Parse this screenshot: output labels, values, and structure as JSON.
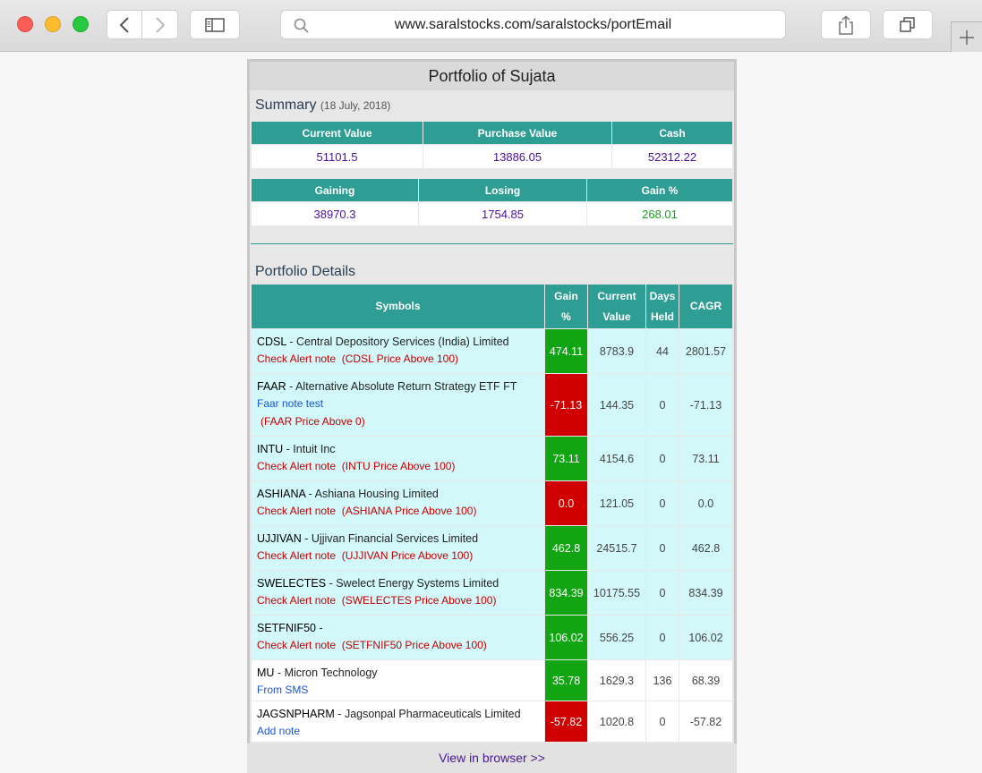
{
  "browser": {
    "url": "www.saralstocks.com/saralstocks/portEmail"
  },
  "portfolio": {
    "title": "Portfolio of Sujata",
    "summary_label": "Summary",
    "summary_date": "(18 July, 2018)",
    "summary1": {
      "headers": [
        "Current Value",
        "Purchase Value",
        "Cash"
      ],
      "values": [
        "51101.5",
        "13886.05",
        "52312.22"
      ]
    },
    "summary2": {
      "headers": [
        "Gaining",
        "Losing",
        "Gain %"
      ],
      "values": [
        "38970.3",
        "1754.85",
        "268.01"
      ]
    },
    "details_label": "Portfolio Details",
    "details_headers": {
      "symbols": "Symbols",
      "gain_1": "Gain",
      "gain_2": "%",
      "current_1": "Current",
      "current_2": "Value",
      "days_1": "Days",
      "days_2": "Held",
      "cagr": "CAGR"
    },
    "rows": [
      {
        "symbol": "CDSL",
        "name": "Central Depository Services (India) Limited",
        "note": "Check Alert note",
        "alert": "(CDSL Price Above 100)",
        "gain": "474.11",
        "current": "8783.9",
        "days": "44",
        "cagr": "2801.57"
      },
      {
        "symbol": "FAAR",
        "name": "Alternative Absolute Return Strategy ETF FT",
        "note": "Faar note test",
        "alert": "(FAAR Price Above 0)",
        "gain": "-71.13",
        "current": "144.35",
        "days": "0",
        "cagr": "-71.13"
      },
      {
        "symbol": "INTU",
        "name": "Intuit Inc",
        "note": "Check Alert note",
        "alert": "(INTU Price Above 100)",
        "gain": "73.11",
        "current": "4154.6",
        "days": "0",
        "cagr": "73.11"
      },
      {
        "symbol": "ASHIANA",
        "name": "Ashiana Housing Limited",
        "note": "Check Alert note",
        "alert": "(ASHIANA Price Above 100)",
        "gain": "0.0",
        "current": "121.05",
        "days": "0",
        "cagr": "0.0"
      },
      {
        "symbol": "UJJIVAN",
        "name": "Ujjivan Financial Services Limited",
        "note": "Check Alert note",
        "alert": "(UJJIVAN Price Above 100)",
        "gain": "462.8",
        "current": "24515.7",
        "days": "0",
        "cagr": "462.8"
      },
      {
        "symbol": "SWELECTES",
        "name": "Swelect Energy Systems Limited",
        "note": "Check Alert note",
        "alert": "(SWELECTES Price Above 100)",
        "gain": "834.39",
        "current": "10175.55",
        "days": "0",
        "cagr": "834.39"
      },
      {
        "symbol": "SETFNIF50",
        "name": "",
        "note": "Check Alert note",
        "alert": "(SETFNIF50 Price Above 100)",
        "gain": "106.02",
        "current": "556.25",
        "days": "0",
        "cagr": "106.02"
      },
      {
        "symbol": "MU",
        "name": "Micron Technology",
        "note": "From SMS",
        "alert": "",
        "gain": "35.78",
        "current": "1629.3",
        "days": "136",
        "cagr": "68.39"
      },
      {
        "symbol": "JAGSNPHARM",
        "name": "Jagsonpal Pharmaceuticals Limited",
        "note": "Add note",
        "alert": "",
        "gain": "-57.82",
        "current": "1020.8",
        "days": "0",
        "cagr": "-57.82"
      }
    ],
    "view_in_browser": "View in browser >>"
  },
  "colors": {
    "header_teal": "#2e9d93",
    "gain_green": "#11a513",
    "loss_red": "#d00000",
    "row_cyan": "#d2f8fa",
    "value_purple": "#4a0f9c"
  }
}
